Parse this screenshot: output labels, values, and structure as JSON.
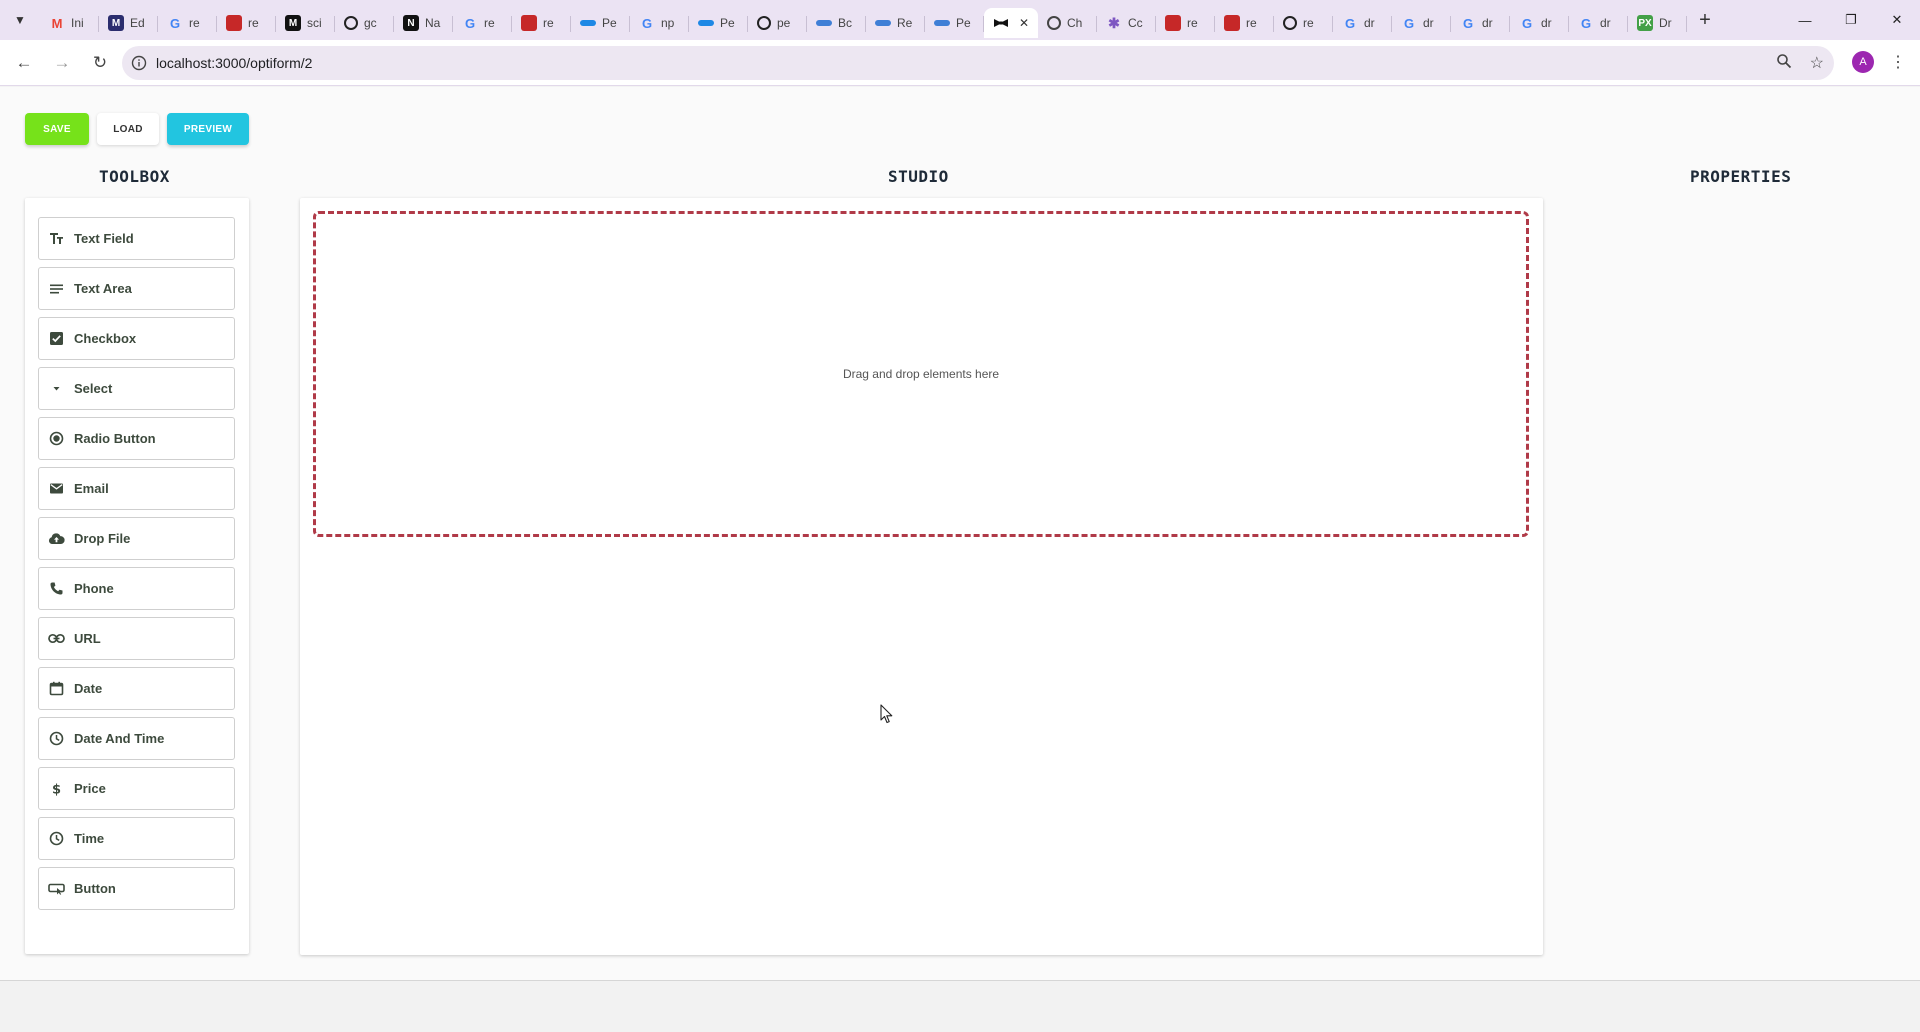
{
  "browser": {
    "tabs": [
      {
        "title": "Ini",
        "favicon": "gmail-icon",
        "color": "#ea4335",
        "glyph": "M",
        "active": false
      },
      {
        "title": "Ed",
        "favicon": "medium-icon",
        "color": "#2b2d6e",
        "glyph": "M",
        "active": false
      },
      {
        "title": "re",
        "favicon": "google-icon",
        "color": "#4285f4",
        "glyph": "G",
        "active": false
      },
      {
        "title": "re",
        "favicon": "red-square-icon",
        "color": "#c62828",
        "glyph": "",
        "active": false
      },
      {
        "title": "sci",
        "favicon": "medium-icon",
        "color": "#111111",
        "glyph": "M",
        "active": false
      },
      {
        "title": "gc",
        "favicon": "github-icon",
        "color": "#222222",
        "glyph": "",
        "active": false
      },
      {
        "title": "Na",
        "favicon": "notion-icon",
        "color": "#111111",
        "glyph": "N",
        "active": false
      },
      {
        "title": "re",
        "favicon": "google-icon",
        "color": "#4285f4",
        "glyph": "G",
        "active": false
      },
      {
        "title": "re",
        "favicon": "red-square-icon",
        "color": "#c62828",
        "glyph": "",
        "active": false
      },
      {
        "title": "Pe",
        "favicon": "blue-strip-icon",
        "color": "#1e88e5",
        "glyph": "",
        "active": false
      },
      {
        "title": "np",
        "favicon": "google-icon",
        "color": "#4285f4",
        "glyph": "G",
        "active": false
      },
      {
        "title": "Pe",
        "favicon": "blue-strip-icon",
        "color": "#1e88e5",
        "glyph": "",
        "active": false
      },
      {
        "title": "pe",
        "favicon": "github-icon",
        "color": "#222222",
        "glyph": "",
        "active": false
      },
      {
        "title": "Bc",
        "favicon": "blue-strip-icon",
        "color": "#3f7fd6",
        "glyph": "",
        "active": false
      },
      {
        "title": "Re",
        "favicon": "blue-strip-icon",
        "color": "#3f7fd6",
        "glyph": "",
        "active": false
      },
      {
        "title": "Pe",
        "favicon": "blue-strip-icon",
        "color": "#3f7fd6",
        "glyph": "",
        "active": false
      },
      {
        "title": "",
        "favicon": "bowtie-icon",
        "color": "#111111",
        "glyph": "",
        "active": true
      },
      {
        "title": "Ch",
        "favicon": "openai-icon",
        "color": "#444444",
        "glyph": "",
        "active": false
      },
      {
        "title": "Cc",
        "favicon": "claude-icon",
        "color": "#7e57c2",
        "glyph": "",
        "active": false
      },
      {
        "title": "re",
        "favicon": "red-square-icon",
        "color": "#c62828",
        "glyph": "",
        "active": false
      },
      {
        "title": "re",
        "favicon": "red-square-icon",
        "color": "#c62828",
        "glyph": "",
        "active": false
      },
      {
        "title": "re",
        "favicon": "github-icon",
        "color": "#222222",
        "glyph": "",
        "active": false
      },
      {
        "title": "dr",
        "favicon": "google-icon",
        "color": "#4285f4",
        "glyph": "G",
        "active": false
      },
      {
        "title": "dr",
        "favicon": "google-icon",
        "color": "#4285f4",
        "glyph": "G",
        "active": false
      },
      {
        "title": "dr",
        "favicon": "google-icon",
        "color": "#4285f4",
        "glyph": "G",
        "active": false
      },
      {
        "title": "dr",
        "favicon": "google-icon",
        "color": "#4285f4",
        "glyph": "G",
        "active": false
      },
      {
        "title": "dr",
        "favicon": "google-icon",
        "color": "#4285f4",
        "glyph": "G",
        "active": false
      },
      {
        "title": "Dr",
        "favicon": "px-icon",
        "color": "#43a047",
        "glyph": "PX",
        "active": false
      }
    ],
    "url": "localhost:3000/optiform/2",
    "avatar_letter": "A",
    "accent_color": "#9c27b0"
  },
  "actions": {
    "save_label": "SAVE",
    "load_label": "LOAD",
    "preview_label": "PREVIEW",
    "save_color": "#76e21a",
    "preview_color": "#22c5e0"
  },
  "columns": {
    "toolbox_title": "TOOLBOX",
    "studio_title": "STUDIO",
    "properties_title": "PROPERTIES"
  },
  "toolbox": {
    "items": [
      {
        "label": "Text Field",
        "icon": "text-fields-icon"
      },
      {
        "label": "Text Area",
        "icon": "lines-icon"
      },
      {
        "label": "Checkbox",
        "icon": "checkbox-icon"
      },
      {
        "label": "Select",
        "icon": "caret-down-icon"
      },
      {
        "label": "Radio Button",
        "icon": "radio-icon"
      },
      {
        "label": "Email",
        "icon": "email-icon"
      },
      {
        "label": "Drop File",
        "icon": "cloud-upload-icon"
      },
      {
        "label": "Phone",
        "icon": "phone-icon"
      },
      {
        "label": "URL",
        "icon": "link-icon"
      },
      {
        "label": "Date",
        "icon": "calendar-icon"
      },
      {
        "label": "Date And Time",
        "icon": "clock-icon"
      },
      {
        "label": "Price",
        "icon": "dollar-icon"
      },
      {
        "label": "Time",
        "icon": "clock-icon"
      },
      {
        "label": "Button",
        "icon": "button-icon"
      }
    ]
  },
  "studio": {
    "dropzone_text": "Drag and drop elements here",
    "dropzone_border_color": "#b03a48"
  }
}
